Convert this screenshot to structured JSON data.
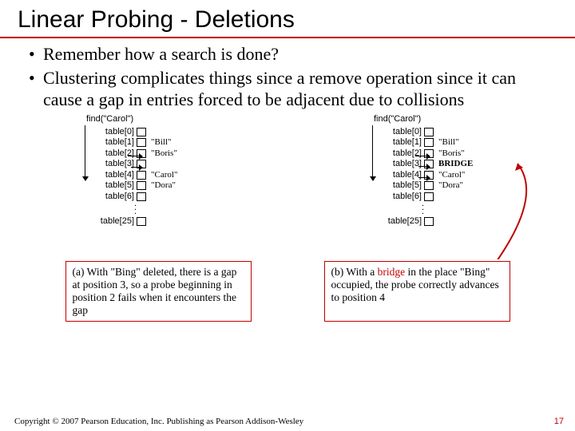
{
  "title": "Linear Probing - Deletions",
  "bullets": [
    "Remember how a search is done?",
    "Clustering complicates things since a remove operation since it can cause a gap in entries forced to be adjacent due to collisions"
  ],
  "diagrams": {
    "findCall": "find(\"Carol\")",
    "a": {
      "rows": [
        {
          "label": "table[0]",
          "value": ""
        },
        {
          "label": "table[1]",
          "value": "\"Bill\""
        },
        {
          "label": "table[2]",
          "value": "\"Boris\""
        },
        {
          "label": "table[3]",
          "value": ""
        },
        {
          "label": "table[4]",
          "value": "\"Carol\""
        },
        {
          "label": "table[5]",
          "value": "\"Dora\""
        },
        {
          "label": "table[6]",
          "value": ""
        }
      ],
      "lastLabel": "table[25]"
    },
    "b": {
      "rows": [
        {
          "label": "table[0]",
          "value": ""
        },
        {
          "label": "table[1]",
          "value": "\"Bill\""
        },
        {
          "label": "table[2]",
          "value": "\"Boris\""
        },
        {
          "label": "table[3]",
          "value": "BRIDGE",
          "bold": true
        },
        {
          "label": "table[4]",
          "value": "\"Carol\""
        },
        {
          "label": "table[5]",
          "value": "\"Dora\""
        },
        {
          "label": "table[6]",
          "value": ""
        }
      ],
      "lastLabel": "table[25]"
    }
  },
  "captions": {
    "a": "(a) With \"Bing\" deleted, there is a gap at position 3, so a probe beginning in position 2 fails when it encounters the gap",
    "b_prefix": "(b) With a ",
    "b_word": "bridge",
    "b_suffix": " in the place \"Bing\" occupied, the probe correctly advances to position 4"
  },
  "copyright": "Copyright © 2007 Pearson Education, Inc. Publishing as Pearson Addison-Wesley",
  "pagenum": "17"
}
